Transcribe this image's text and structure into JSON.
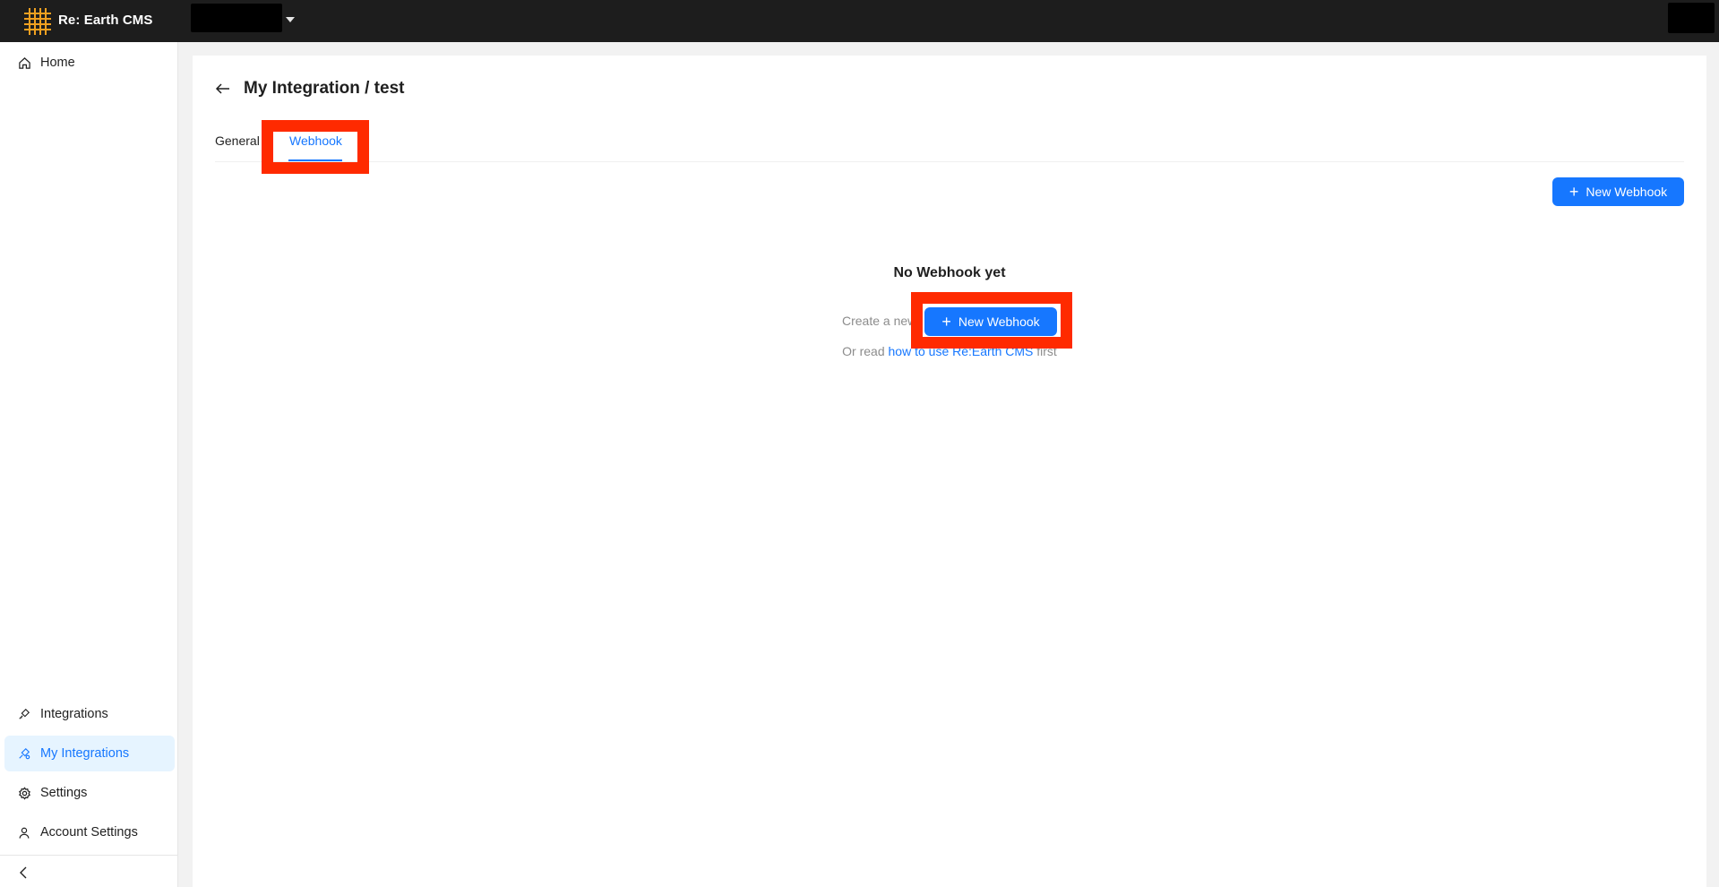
{
  "app": {
    "brand": "Re: Earth CMS"
  },
  "sidebar": {
    "items": [
      {
        "label": "Home",
        "icon": "home-icon"
      },
      {
        "label": "Integrations",
        "icon": "integration-icon"
      },
      {
        "label": "My Integrations",
        "icon": "my-integration-icon",
        "active": true
      },
      {
        "label": "Settings",
        "icon": "gear-icon"
      },
      {
        "label": "Account Settings",
        "icon": "user-icon"
      }
    ],
    "collapse_icon": "chevron-left-icon"
  },
  "main": {
    "title": "My Integration / test",
    "tabs": [
      {
        "label": "General"
      },
      {
        "label": "Webhook",
        "active": true
      }
    ],
    "new_webhook_label": "New Webhook",
    "empty": {
      "title": "No Webhook yet",
      "create_text": "Create a new",
      "read_prefix": "Or read",
      "link_text": "how to use Re:Earth CMS",
      "read_suffix": "first"
    }
  },
  "colors": {
    "accent": "#1677ff",
    "highlight": "#ff2a00",
    "topbar": "#1d1d1d"
  }
}
